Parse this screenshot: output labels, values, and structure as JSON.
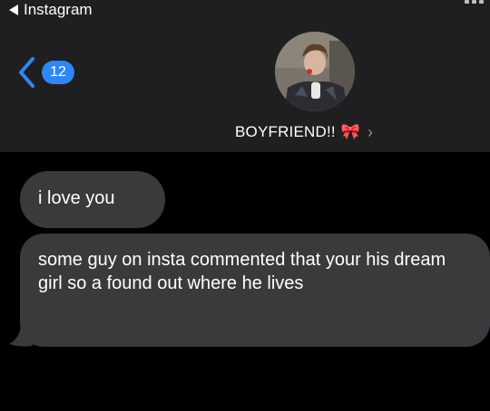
{
  "status_bar": {
    "back_app": "Instagram",
    "back_icon": "back-triangle-icon"
  },
  "nav": {
    "back_icon": "chevron-left-icon",
    "unread_count": "12"
  },
  "contact": {
    "name": "BOYFRIEND!!",
    "emoji": "🎀",
    "chevron": "›",
    "avatar_icon": "contact-photo"
  },
  "messages": [
    {
      "text": "i love you"
    },
    {
      "text": "some guy on insta commented that your his dream girl so a found out where he lives"
    }
  ],
  "colors": {
    "header_bg": "#1f1f21",
    "bubble_bg": "#3a3a3c",
    "accent": "#2e87f5",
    "background": "#000000"
  }
}
